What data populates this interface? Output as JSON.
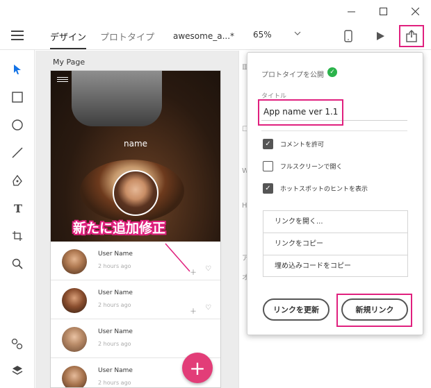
{
  "toolbar": {
    "tab_design": "デザイン",
    "tab_prototype": "プロトタイプ",
    "doc_name": "awesome_a...*",
    "zoom": "65%"
  },
  "canvas": {
    "page_label": "My Page",
    "hero_name": "name",
    "annotation": "新たに追加修正",
    "rows": [
      {
        "name": "User Name",
        "time": "2 hours ago"
      },
      {
        "name": "User Name",
        "time": "2 hours ago"
      },
      {
        "name": "User Name",
        "time": "2 hours ago"
      },
      {
        "name": "User Name",
        "time": "2 hours ago"
      }
    ],
    "fab_symbol": "+"
  },
  "popup": {
    "publish_label": "プロトタイプを公開",
    "title_label": "タイトル",
    "title_value": "App name ver 1.1",
    "options": [
      {
        "label": "コメントを許可",
        "checked": true
      },
      {
        "label": "フルスクリーンで開く",
        "checked": false
      },
      {
        "label": "ホットスポットのヒントを表示",
        "checked": true
      }
    ],
    "links": [
      "リンクを開く...",
      "リンクをコピー",
      "埋め込みコードをコピー"
    ],
    "btn_update": "リンクを更新",
    "btn_new": "新規リンク"
  },
  "colors": {
    "highlight": "#e0207e",
    "fab": "#e23d78",
    "publish_ok": "#2bb34b",
    "select_tool": "#1473e6"
  }
}
